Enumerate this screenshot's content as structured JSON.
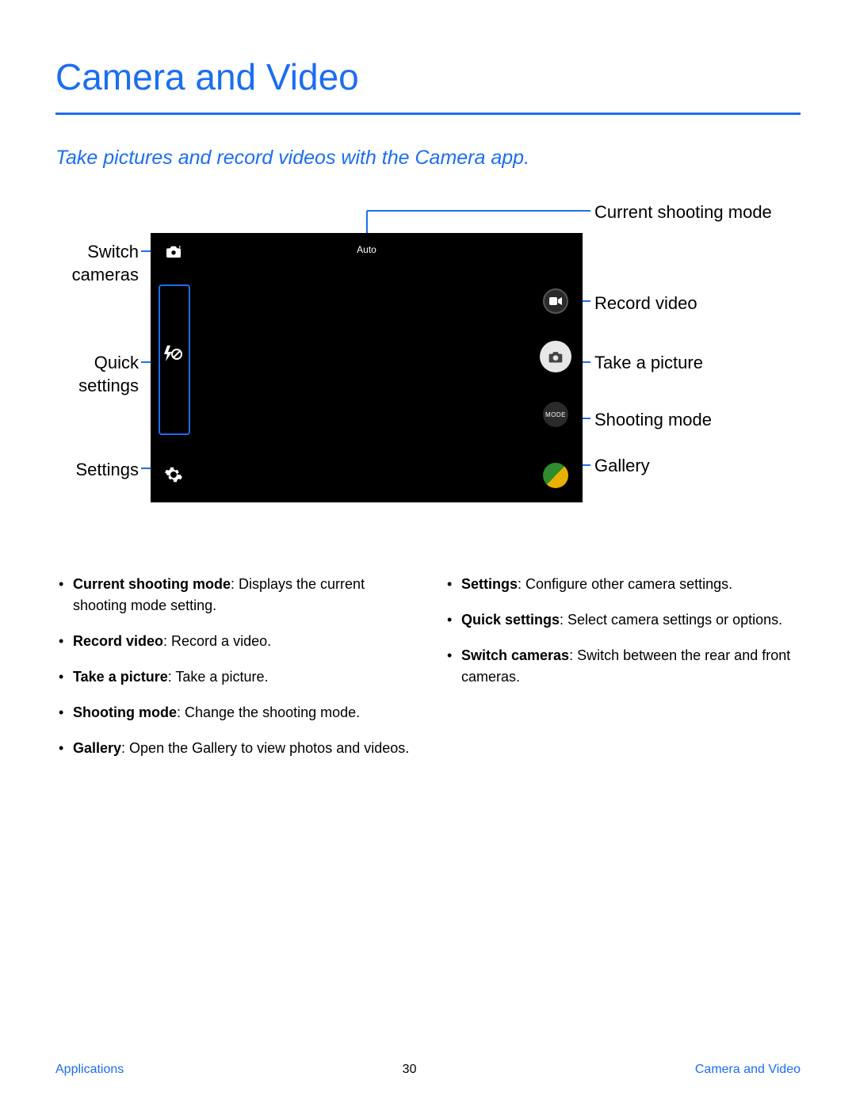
{
  "title": "Camera and Video",
  "subtitle": "Take pictures and record videos with the Camera app.",
  "camera_ui": {
    "mode_text": "Auto",
    "mode_button_text": "MODE"
  },
  "callouts": {
    "switch_cameras": "Switch cameras",
    "quick_settings": "Quick settings",
    "settings": "Settings",
    "current_mode": "Current shooting mode",
    "record_video": "Record video",
    "take_picture": "Take a picture",
    "shooting_mode": "Shooting mode",
    "gallery": "Gallery"
  },
  "bullets_left": [
    {
      "term": "Current shooting mode",
      "desc": ": Displays the current shooting mode setting."
    },
    {
      "term": "Record video",
      "desc": ": Record a video."
    },
    {
      "term": "Take a picture",
      "desc": ": Take a picture."
    },
    {
      "term": "Shooting mode",
      "desc": ": Change the shooting mode."
    },
    {
      "term": "Gallery",
      "desc": ": Open the Gallery to view photos and videos."
    }
  ],
  "bullets_right": [
    {
      "term": "Settings",
      "desc": ": Configure other camera settings."
    },
    {
      "term": "Quick settings",
      "desc": ": Select camera settings or options."
    },
    {
      "term": "Switch cameras",
      "desc": ": Switch between the rear and front cameras."
    }
  ],
  "footer": {
    "left": "Applications",
    "center": "30",
    "right": "Camera and Video"
  }
}
